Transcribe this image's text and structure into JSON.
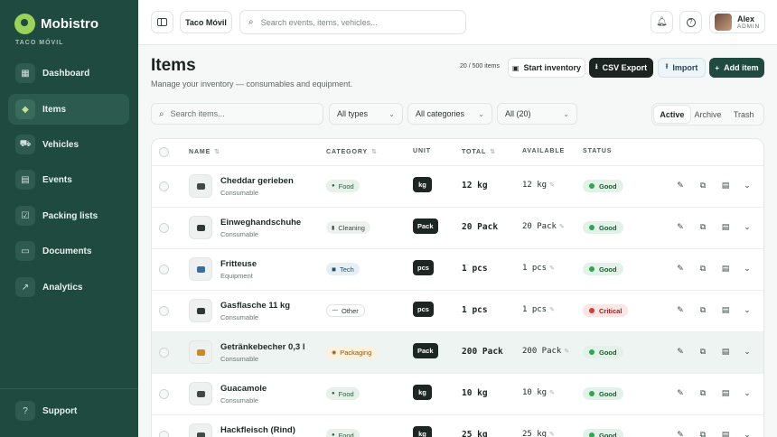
{
  "brand": {
    "name": "Mobistro",
    "subtitle": "TACO MÓVIL"
  },
  "sidebar": {
    "items": [
      {
        "label": "Dashboard",
        "icon": "dashboard-icon",
        "glyph": "▦"
      },
      {
        "label": "Items",
        "icon": "box-icon",
        "glyph": "◆"
      },
      {
        "label": "Vehicles",
        "icon": "truck-icon",
        "glyph": "⛟"
      },
      {
        "label": "Events",
        "icon": "calendar-icon",
        "glyph": "▤"
      },
      {
        "label": "Packing lists",
        "icon": "checklist-icon",
        "glyph": "☑"
      },
      {
        "label": "Documents",
        "icon": "document-icon",
        "glyph": "▭"
      },
      {
        "label": "Analytics",
        "icon": "chart-icon",
        "glyph": "↗"
      }
    ],
    "support_label": "Support",
    "active_index": 1
  },
  "topbar": {
    "truck_name": "Taco Móvil",
    "search_placeholder": "Search events, items, vehicles...",
    "user_name": "Alex",
    "user_role": "ADMIN"
  },
  "header": {
    "title": "Items",
    "subtitle": "Manage your inventory — consumables and equipment.",
    "count": "20 / 500 items",
    "start_inventory": "Start inventory",
    "csv_export": "CSV Export",
    "import": "Import",
    "add_item": "Add item"
  },
  "filters": {
    "search_placeholder": "Search items...",
    "type": "All types",
    "category": "All categories",
    "count": "All (20)",
    "tabs": [
      "Active",
      "Archive",
      "Trash"
    ],
    "active_tab": "Active"
  },
  "table": {
    "columns": [
      "NAME",
      "CATEGORY",
      "UNIT",
      "TOTAL",
      "AVAILABLE",
      "STATUS"
    ],
    "rows": [
      {
        "name": "Cheddar gerieben",
        "type": "Consumable",
        "category": "Food",
        "unit": "kg",
        "total": "12 kg",
        "available": "12 kg",
        "status": "Good"
      },
      {
        "name": "Einweghandschuhe",
        "type": "Consumable",
        "category": "Cleaning",
        "unit": "Pack",
        "total": "20 Pack",
        "available": "20 Pack",
        "status": "Good"
      },
      {
        "name": "Fritteuse",
        "type": "Equipment",
        "category": "Tech",
        "unit": "pcs",
        "total": "1 pcs",
        "available": "1 pcs",
        "status": "Good"
      },
      {
        "name": "Gasflasche 11 kg",
        "type": "Consumable",
        "category": "Other",
        "unit": "pcs",
        "total": "1 pcs",
        "available": "1 pcs",
        "status": "Critical"
      },
      {
        "name": "Getränkebecher 0,3 l",
        "type": "Consumable",
        "category": "Packaging",
        "unit": "Pack",
        "total": "200 Pack",
        "available": "200 Pack",
        "status": "Good"
      },
      {
        "name": "Guacamole",
        "type": "Consumable",
        "category": "Food",
        "unit": "kg",
        "total": "10 kg",
        "available": "10 kg",
        "status": "Good"
      },
      {
        "name": "Hackfleisch (Rind)",
        "type": "Consumable",
        "category": "Food",
        "unit": "kg",
        "total": "25 kg",
        "available": "25 kg",
        "status": "Good"
      }
    ]
  },
  "colors": {
    "sidebar": "#1f4a3f",
    "accent": "#1f4a3f",
    "brand_logo": "#9bd35a",
    "good": "#2fa651",
    "critical": "#d63b3b"
  }
}
